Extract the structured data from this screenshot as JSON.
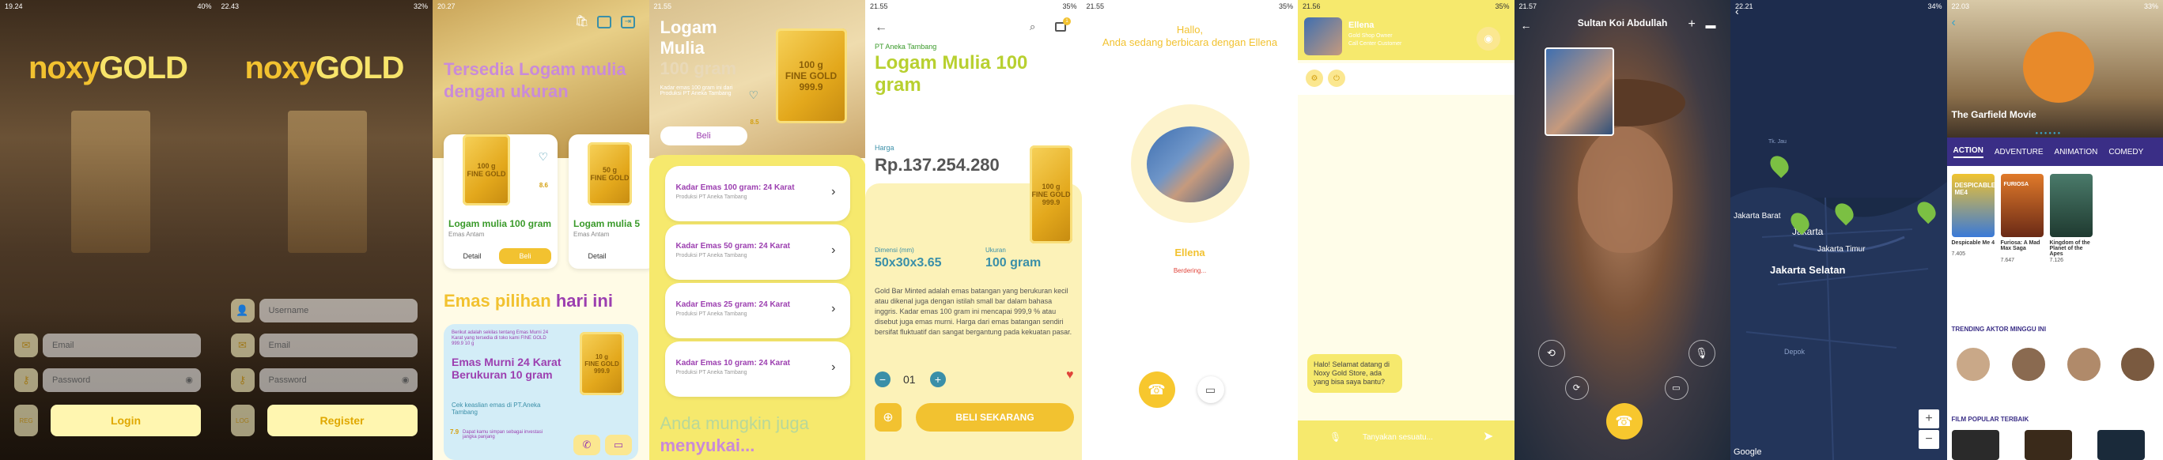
{
  "screens": {
    "s1": {
      "status_time": "19.24",
      "status_right": "40%",
      "logo_a": "noxy",
      "logo_b": "GOLD",
      "email_placeholder": "Email",
      "password_placeholder": "Password",
      "reg_label": "REG",
      "login_label": "Login"
    },
    "s2": {
      "status_time": "22.43",
      "status_right": "32%",
      "logo_a": "noxy",
      "logo_b": "GOLD",
      "username_placeholder": "Username",
      "email_placeholder": "Email",
      "password_placeholder": "Password",
      "log_label": "LOG",
      "register_label": "Register"
    },
    "s3": {
      "status_time": "20.27",
      "status_right": "",
      "headline_1": "Tersedia Logam mulia",
      "headline_2": "dengan ukuran",
      "card1_title": "Logam mulia 100 gram",
      "card1_sub": "Emas Antam",
      "card1_badge": "8.6",
      "card1_bar": "100 g\nFINE GOLD",
      "card2_title": "Logam mulia 5",
      "card2_sub": "Emas Antam",
      "card2_bar": "50 g\nFINE GOLD",
      "detail_label": "Detail",
      "beli_label": "Beli",
      "section_a": "Emas pilihan ",
      "section_b": "hari ini",
      "promo_small": "Berikut adalah sekilas tentang Emas Murni 24 Karat yang tersedia di toko kami FINE GOLD 999.9 10 g",
      "promo_title": "Emas Murni 24 Karat Berukuran 10 gram",
      "promo_sub": "Cek keaslian emas di PT.Aneka Tambang",
      "promo_note": "Dapat kamu simpan sebagai investasi jangka panjang",
      "promo_badge": "7.9",
      "promo_bar": "10 g\nFINE GOLD\n999.9"
    },
    "s4": {
      "status_time": "21.55",
      "status_right": "",
      "title_1": "Logam",
      "title_2": "Mulia",
      "title_3": "100 gram",
      "bar_text": "100 g\nFINE GOLD\n999.9",
      "desc": "Kadar emas 100 gram ini dari Produksi PT Aneka Tambang",
      "badge": "8.5",
      "beli_label": "Beli",
      "items": [
        {
          "title": "Kadar Emas 100 gram: 24 Karat",
          "sub": "Produksi PT Aneka Tambang"
        },
        {
          "title": "Kadar Emas 50 gram: 24 Karat",
          "sub": "Produksi PT Aneka Tambang"
        },
        {
          "title": "Kadar Emas 25 gram: 24 Karat",
          "sub": "Produksi PT Aneka Tambang"
        },
        {
          "title": "Kadar Emas 10 gram: 24 Karat",
          "sub": "Produksi PT Aneka Tambang"
        }
      ],
      "footer_1": "Anda mungkin juga",
      "footer_2": "menyukai..."
    },
    "s5": {
      "status_time": "21.55",
      "status_right": "35%",
      "brand": "PT Aneka Tambang",
      "title": "Logam Mulia 100 gram",
      "price_label": "Harga",
      "price": "Rp.137.254.280",
      "bar_text": "100 g\nFINE GOLD\n999.9",
      "dim_label": "Dimensi (mm)",
      "dim_value": "50x30x3.65",
      "size_label": "Ukuran",
      "size_value": "100 gram",
      "body": "Gold Bar Minted adalah emas batangan yang berukuran kecil atau dikenal juga dengan istilah small bar dalam bahasa inggris. Kadar emas 100 gram ini mencapai 999,9 % atau disebut juga emas murni. Harga dari emas batangan sendiri bersifat fluktuatif dan sangat bergantung pada kekuatan pasar.",
      "qty_minus": "−",
      "qty_value": "01",
      "qty_plus": "+",
      "cart_badge": "1",
      "buy_label": "BELI SEKARANG"
    },
    "s6": {
      "status_time": "21.55",
      "status_right": "35%",
      "greeting_1": "Hallo,",
      "greeting_2": "Anda sedang berbicara dengan Ellena",
      "name": "Ellena",
      "status": "Berdering..."
    },
    "s7": {
      "status_time": "21.56",
      "status_right": "35%",
      "name": "Ellena",
      "role_1": "Gold Shop Owner",
      "role_2": "Call Center Customer",
      "message": "Halo! Selamat datang di Noxy Gold Store, ada yang bisa saya bantu?",
      "input_placeholder": "Tanyakan sesuatu..."
    },
    "s8": {
      "status_time": "21.57",
      "status_right": "",
      "name": "Sultan Koi Abdullah"
    },
    "s9": {
      "status_time": "22.21",
      "status_right": "34%",
      "labels": [
        "Tk. Jau",
        "Jakarta Barat",
        "Jakarta",
        "Jakarta Timur",
        "Jakarta Selatan",
        "Depok"
      ],
      "zoom_in": "+",
      "zoom_out": "−",
      "attribution": "Google"
    },
    "s10": {
      "status_time": "22.03",
      "status_right": "33%",
      "hero_title": "The Garfield Movie",
      "tabs": [
        "ACTION",
        "ADVENTURE",
        "ANIMATION",
        "COMEDY"
      ],
      "movies": [
        {
          "title": "Despicable Me 4",
          "rating": "7.405"
        },
        {
          "title": "Furiosa: A Mad Max Saga",
          "rating": "7.647"
        },
        {
          "title": "Kingdom of the Planet of the Apes",
          "rating": "7.126"
        }
      ],
      "trending_label": "TRENDING AKTOR MINGGU INI",
      "popular_label": "FILM POPULAR TERBAIK",
      "poster_1": "DESPICABLE ME4",
      "poster_2": "FURIOSA"
    }
  },
  "colors": {
    "gold": "#f2c230",
    "yellow_bg": "#f6e96d",
    "purple": "#9c3fb0",
    "teal": "#3a8fa8",
    "navy": "#182a4a"
  }
}
